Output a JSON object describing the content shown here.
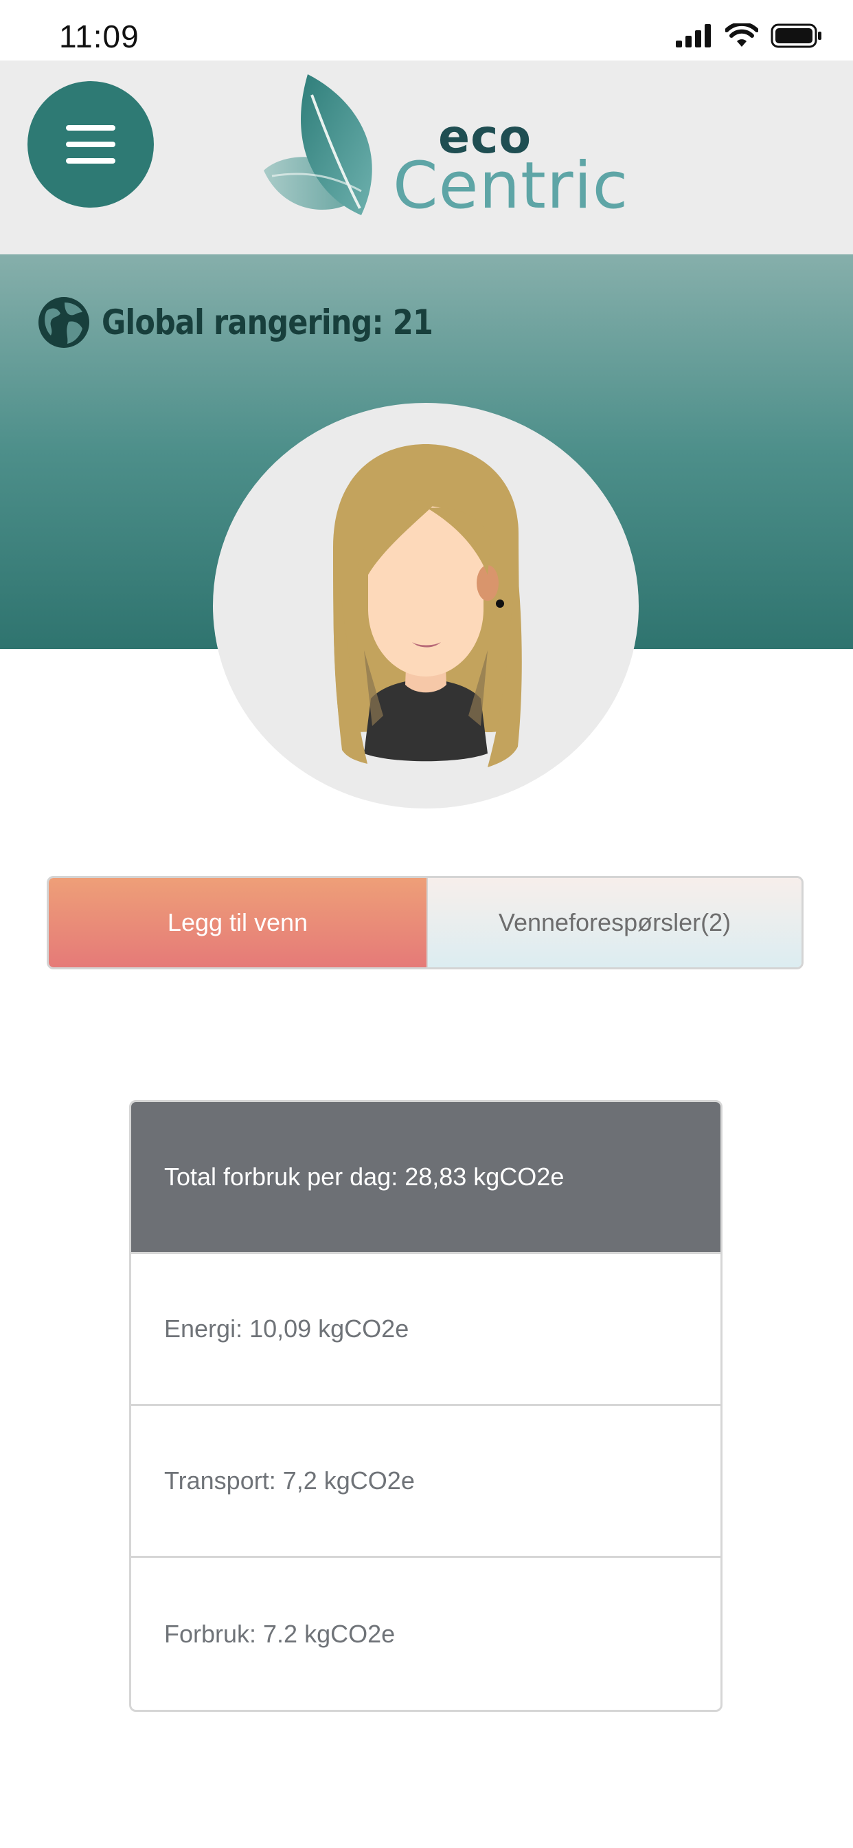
{
  "status_bar": {
    "time": "11:09",
    "icons": [
      "cellular-signal-icon",
      "wifi-icon",
      "battery-icon"
    ]
  },
  "header": {
    "menu_icon": "hamburger-menu-icon",
    "logo": {
      "top_word": "eco",
      "bottom_word": "Centric"
    }
  },
  "profile": {
    "global_rank_label": "Global rangering: 21",
    "rank_icon": "globe-icon",
    "avatar_icon": "user-avatar-icon"
  },
  "actions": {
    "add_friend": "Legg til venn",
    "friend_requests": "Venneforespørsler(2)"
  },
  "stats": {
    "total": "Total forbruk per dag:  28,83 kgCO2e",
    "energy": "Energi: 10,09 kgCO2e",
    "transport": "Transport: 7,2 kgCO2e",
    "consumption": "Forbruk:  7.2 kgCO2e"
  },
  "colors": {
    "brand_teal": "#2e7a74",
    "logo_light": "#5ea5a6",
    "logo_dark": "#1f4e52",
    "button_coral": "#e57a78",
    "stat_header": "#6d7075"
  }
}
